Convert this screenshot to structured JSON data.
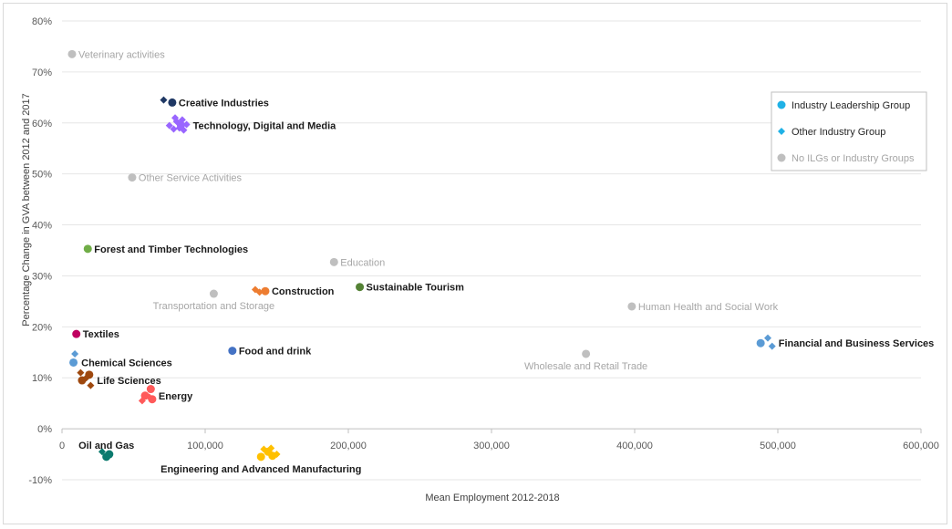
{
  "chart_data": {
    "type": "scatter",
    "title": "",
    "xlabel": "Mean Employment  2012-2018",
    "ylabel": "Percentage Change in GVA between 2012 and 2017",
    "xlim": [
      0,
      600000
    ],
    "ylim": [
      -10,
      80
    ],
    "x_ticks": [
      0,
      100000,
      200000,
      300000,
      400000,
      500000,
      600000
    ],
    "x_tick_labels": [
      "0",
      "100,000",
      "200,000",
      "300,000",
      "400,000",
      "500,000",
      "600,000"
    ],
    "y_ticks": [
      -10,
      0,
      10,
      20,
      30,
      40,
      50,
      60,
      70,
      80
    ],
    "y_tick_labels": [
      "-10%",
      "0%",
      "10%",
      "20%",
      "30%",
      "40%",
      "50%",
      "60%",
      "70%",
      "80%"
    ],
    "grid": "horizontal",
    "legend_position": "right",
    "legend": [
      {
        "label": "Industry Leadership Group",
        "marker": "circle",
        "color": "#1fb1e6",
        "grey": false
      },
      {
        "label": "Other Industry Group",
        "marker": "diamond",
        "color": "#1fb1e6",
        "grey": false
      },
      {
        "label": "No ILGs or Industry Groups",
        "marker": "circle",
        "color": "#bfbfbf",
        "grey": true
      }
    ],
    "series": [
      {
        "name": "Veterinary activities",
        "style": "grey",
        "color": "#bfbfbf",
        "label_side": "right",
        "points": [
          {
            "x": 7000,
            "y": 73.5,
            "m": "c"
          }
        ]
      },
      {
        "name": "Creative Industries",
        "style": "bold",
        "color": "#1f3864",
        "label_side": "right",
        "points": [
          {
            "x": 77000,
            "y": 64,
            "m": "c"
          },
          {
            "x": 71000,
            "y": 64.5,
            "m": "d"
          }
        ]
      },
      {
        "name": "Technology, Digital and Media",
        "style": "bold",
        "color": "#9966ff",
        "label_side": "right",
        "points": [
          {
            "x": 75000,
            "y": 59.5,
            "m": "d"
          },
          {
            "x": 78000,
            "y": 58.8,
            "m": "d"
          },
          {
            "x": 80000,
            "y": 60.3,
            "m": "d"
          },
          {
            "x": 82000,
            "y": 59,
            "m": "d"
          },
          {
            "x": 84000,
            "y": 60.6,
            "m": "d"
          },
          {
            "x": 85000,
            "y": 58.6,
            "m": "d"
          },
          {
            "x": 87000,
            "y": 59.7,
            "m": "d"
          },
          {
            "x": 79000,
            "y": 61,
            "m": "d"
          },
          {
            "x": 83000,
            "y": 59.6,
            "m": "c"
          }
        ]
      },
      {
        "name": "Other Service Activities",
        "style": "grey",
        "color": "#bfbfbf",
        "label_side": "right",
        "points": [
          {
            "x": 49000,
            "y": 49.3,
            "m": "c"
          }
        ]
      },
      {
        "name": "Forest and Timber Technologies",
        "style": "bold",
        "color": "#70ad47",
        "label_side": "right",
        "points": [
          {
            "x": 18000,
            "y": 35.3,
            "m": "c"
          }
        ]
      },
      {
        "name": "Education",
        "style": "grey",
        "color": "#bfbfbf",
        "label_side": "right",
        "points": [
          {
            "x": 190000,
            "y": 32.7,
            "m": "c"
          }
        ]
      },
      {
        "name": "Sustainable Tourism",
        "style": "bold",
        "color": "#548235",
        "label_side": "right",
        "points": [
          {
            "x": 208000,
            "y": 27.8,
            "m": "c"
          }
        ]
      },
      {
        "name": "Construction",
        "style": "bold",
        "color": "#ed7d31",
        "label_side": "right",
        "points": [
          {
            "x": 142000,
            "y": 27,
            "m": "c"
          },
          {
            "x": 135000,
            "y": 27.3,
            "m": "d"
          },
          {
            "x": 138000,
            "y": 26.8,
            "m": "d"
          }
        ]
      },
      {
        "name": "Transportation and Storage",
        "style": "grey",
        "color": "#bfbfbf",
        "label_side": "below-center",
        "points": [
          {
            "x": 106000,
            "y": 26.5,
            "m": "c"
          }
        ]
      },
      {
        "name": "Human Health and Social Work",
        "style": "grey",
        "color": "#bfbfbf",
        "label_side": "right",
        "points": [
          {
            "x": 398000,
            "y": 24,
            "m": "c"
          }
        ]
      },
      {
        "name": "Textiles",
        "style": "bold",
        "color": "#c00060",
        "label_side": "right",
        "points": [
          {
            "x": 10000,
            "y": 18.6,
            "m": "c"
          }
        ]
      },
      {
        "name": "Food and drink",
        "style": "bold",
        "color": "#4472c4",
        "label_side": "right",
        "points": [
          {
            "x": 119000,
            "y": 15.3,
            "m": "c"
          }
        ]
      },
      {
        "name": "Wholesale and Retail Trade",
        "style": "grey",
        "color": "#bfbfbf",
        "label_side": "below-center",
        "points": [
          {
            "x": 366000,
            "y": 14.7,
            "m": "c"
          }
        ]
      },
      {
        "name": "Financial and Business Services",
        "style": "bold",
        "color": "#5b9bd5",
        "label_side": "right",
        "points": [
          {
            "x": 488000,
            "y": 16.8,
            "m": "c"
          },
          {
            "x": 493000,
            "y": 17.8,
            "m": "d"
          },
          {
            "x": 496000,
            "y": 16.2,
            "m": "d"
          }
        ]
      },
      {
        "name": "Chemical Sciences",
        "style": "bold",
        "color": "#5b9bd5",
        "label_side": "right",
        "points": [
          {
            "x": 8000,
            "y": 13,
            "m": "c"
          },
          {
            "x": 9000,
            "y": 14.7,
            "m": "d"
          }
        ]
      },
      {
        "name": "Life Sciences",
        "style": "bold",
        "color": "#9e480e",
        "label_side": "right",
        "points": [
          {
            "x": 14000,
            "y": 9.5,
            "m": "c"
          },
          {
            "x": 19000,
            "y": 10.6,
            "m": "c"
          },
          {
            "x": 13000,
            "y": 11,
            "m": "d"
          },
          {
            "x": 20000,
            "y": 8.5,
            "m": "d"
          },
          {
            "x": 17000,
            "y": 10,
            "m": "d"
          }
        ]
      },
      {
        "name": "Energy",
        "style": "bold",
        "color": "#ff5a5a",
        "label_side": "right",
        "points": [
          {
            "x": 58000,
            "y": 6.5,
            "m": "c"
          },
          {
            "x": 62000,
            "y": 7.8,
            "m": "c"
          },
          {
            "x": 63000,
            "y": 5.8,
            "m": "c"
          },
          {
            "x": 56000,
            "y": 5.5,
            "m": "d"
          },
          {
            "x": 61000,
            "y": 6.2,
            "m": "d"
          }
        ]
      },
      {
        "name": "Oil and Gas",
        "style": "bold",
        "color": "#0b7a6e",
        "label_side": "above-center",
        "points": [
          {
            "x": 31000,
            "y": -5.5,
            "m": "c"
          },
          {
            "x": 33000,
            "y": -5,
            "m": "c"
          },
          {
            "x": 28000,
            "y": -4.5,
            "m": "d"
          }
        ]
      },
      {
        "name": "Engineering and Advanced Manufacturing",
        "style": "bold",
        "color": "#ffc000",
        "label_side": "below-center",
        "points": [
          {
            "x": 139000,
            "y": -5.5,
            "m": "c"
          },
          {
            "x": 144000,
            "y": -4.5,
            "m": "c"
          },
          {
            "x": 147000,
            "y": -5.3,
            "m": "c"
          },
          {
            "x": 141000,
            "y": -4,
            "m": "d"
          },
          {
            "x": 146000,
            "y": -3.8,
            "m": "d"
          },
          {
            "x": 150000,
            "y": -5,
            "m": "d"
          }
        ]
      }
    ]
  }
}
